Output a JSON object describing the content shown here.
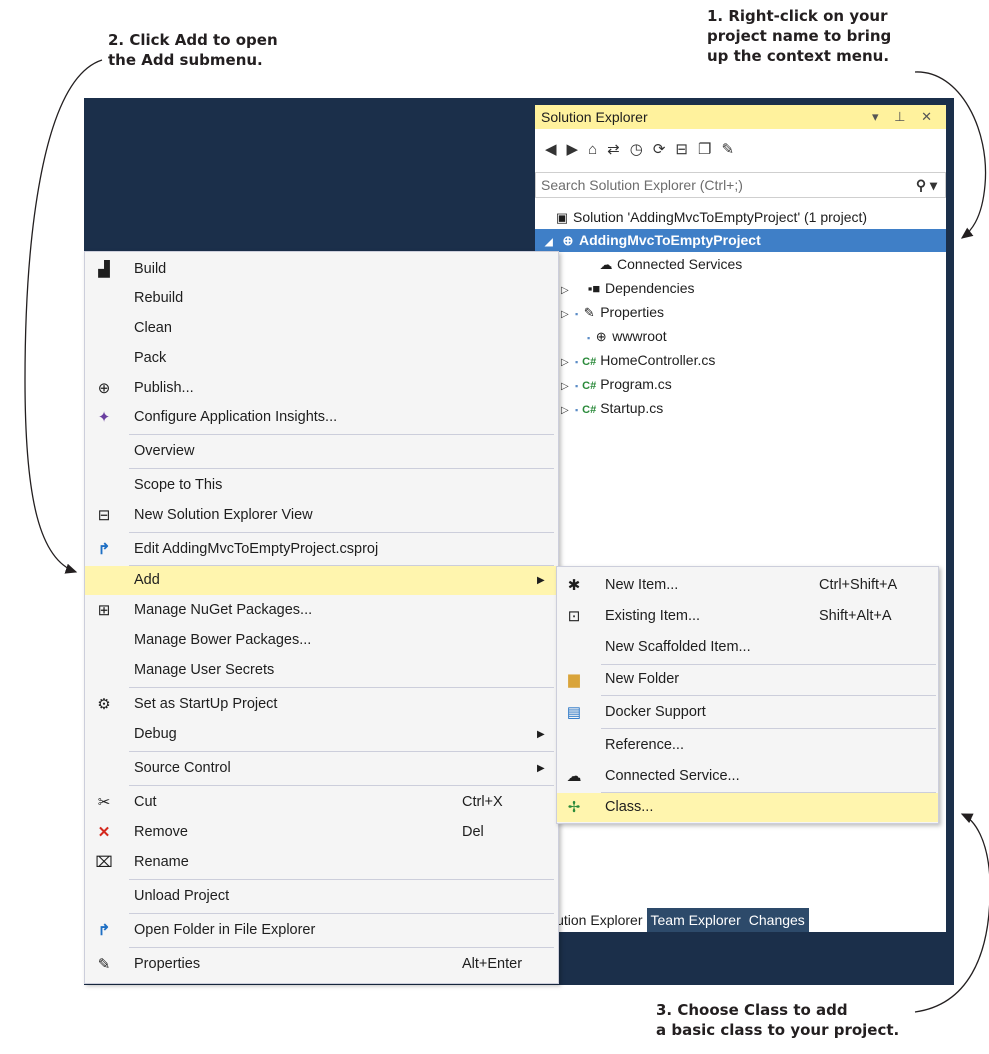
{
  "callouts": {
    "right_click": [
      "1. Right-click on your",
      "project name to bring",
      "up the context menu."
    ],
    "add": [
      "2. Click Add to open",
      "the Add submenu."
    ],
    "class": [
      "3. Choose Class to add",
      "a basic class to your project."
    ]
  },
  "solution_explorer": {
    "title": "Solution Explorer",
    "title_controls": "▾ ⊥ ✕",
    "search_placeholder": "Search Solution Explorer (Ctrl+;)",
    "tree": [
      {
        "label": "Solution 'AddingMvcToEmptyProject' (1 project)",
        "icon": "solution-icon"
      },
      {
        "label": "AddingMvcToEmptyProject",
        "icon": "web-project-icon",
        "selected": true
      },
      {
        "label": "Connected Services",
        "icon": "cloud-icon"
      },
      {
        "label": "Dependencies",
        "icon": "dependencies-icon"
      },
      {
        "label": "Properties",
        "icon": "wrench-icon"
      },
      {
        "label": "wwwroot",
        "icon": "globe-icon"
      },
      {
        "label": "HomeController.cs",
        "icon": "csharp-file-icon"
      },
      {
        "label": "Program.cs",
        "icon": "csharp-file-icon"
      },
      {
        "label": "Startup.cs",
        "icon": "csharp-file-icon"
      }
    ],
    "tabs": [
      "lution Explorer",
      "Team Explorer",
      "Changes"
    ]
  },
  "context_menu": {
    "items": [
      {
        "label": "Build",
        "icon": "build-icon"
      },
      {
        "label": "Rebuild"
      },
      {
        "label": "Clean"
      },
      {
        "label": "Pack"
      },
      {
        "label": "Publish...",
        "icon": "publish-icon"
      },
      {
        "label": "Configure Application Insights...",
        "icon": "insights-icon"
      },
      {
        "label": "Overview"
      },
      {
        "label": "Scope to This"
      },
      {
        "label": "New Solution Explorer View",
        "icon": "new-view-icon"
      },
      {
        "label": "Edit AddingMvcToEmptyProject.csproj",
        "icon": "edit-project-icon"
      },
      {
        "label": "Add",
        "highlighted": true
      },
      {
        "label": "Manage NuGet Packages...",
        "icon": "nuget-icon"
      },
      {
        "label": "Manage Bower Packages..."
      },
      {
        "label": "Manage User Secrets"
      },
      {
        "label": "Set as StartUp Project",
        "icon": "gear-icon"
      },
      {
        "label": "Debug"
      },
      {
        "label": "Source Control"
      },
      {
        "label": "Cut",
        "shortcut": "Ctrl+X",
        "icon": "scissors-icon"
      },
      {
        "label": "Remove",
        "shortcut": "Del",
        "icon": "remove-icon"
      },
      {
        "label": "Rename",
        "icon": "rename-icon"
      },
      {
        "label": "Unload Project"
      },
      {
        "label": "Open Folder in File Explorer",
        "icon": "open-folder-icon"
      },
      {
        "label": "Properties",
        "shortcut": "Alt+Enter",
        "icon": "wrench-icon"
      }
    ]
  },
  "add_submenu": {
    "items": [
      {
        "label": "New Item...",
        "shortcut": "Ctrl+Shift+A",
        "icon": "new-item-icon"
      },
      {
        "label": "Existing Item...",
        "shortcut": "Shift+Alt+A",
        "icon": "existing-item-icon"
      },
      {
        "label": "New Scaffolded Item..."
      },
      {
        "label": "New Folder",
        "icon": "new-folder-icon"
      },
      {
        "label": "Docker Support",
        "icon": "docker-icon"
      },
      {
        "label": "Reference..."
      },
      {
        "label": "Connected Service...",
        "icon": "connected-service-icon"
      },
      {
        "label": "Class...",
        "icon": "class-icon",
        "highlighted": true
      }
    ]
  },
  "colors": {
    "ide_background": "#1b2f4a",
    "title_bar": "#fff29d",
    "selection": "#3f7fc7",
    "menu_highlight": "#fff5ae"
  }
}
